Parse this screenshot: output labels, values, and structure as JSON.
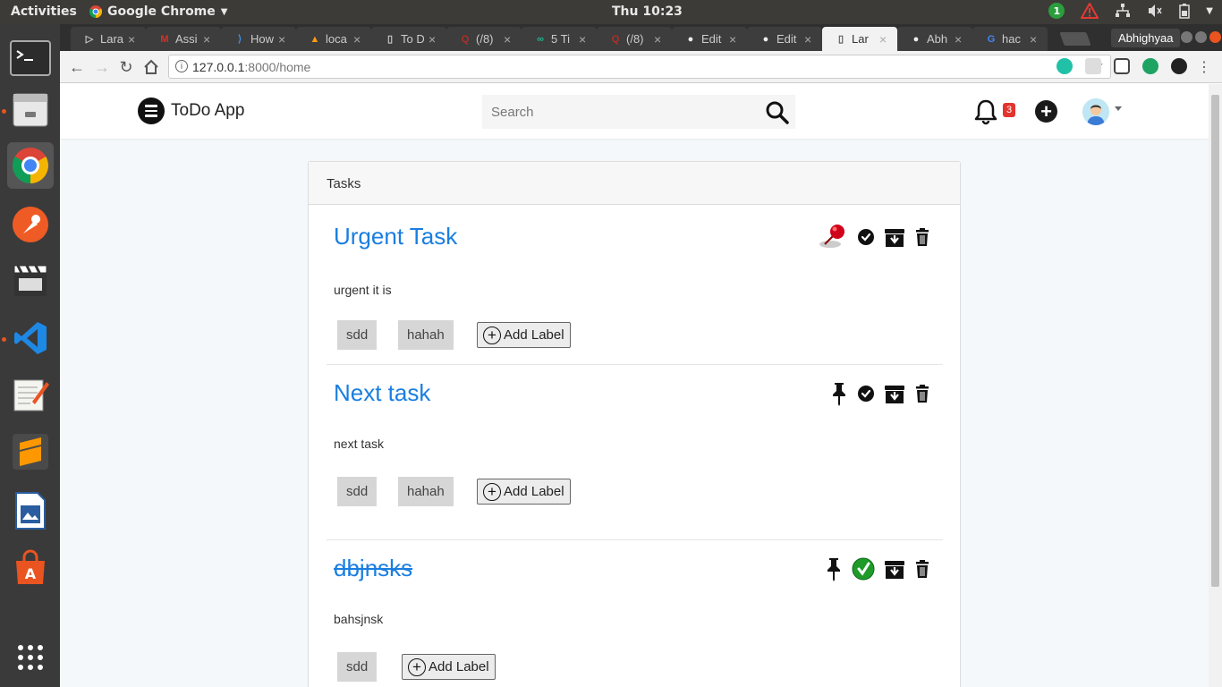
{
  "topbar": {
    "activities": "Activities",
    "app_name": "Google Chrome",
    "clock": "Thu 10:23",
    "notif_count": "1"
  },
  "dock": {
    "apps": [
      "terminal-icon",
      "files-icon",
      "chrome-icon",
      "postman-icon",
      "video-editor-icon",
      "vscode-icon",
      "text-editor-icon",
      "sublime-icon",
      "writer-icon",
      "software-center-icon",
      "app-grid-icon"
    ]
  },
  "browser": {
    "tabs": [
      {
        "label": "Lara",
        "icon": "laravel-icon"
      },
      {
        "label": "Assi",
        "icon": "gmail-icon"
      },
      {
        "label": "How",
        "icon": "stackexchange-icon"
      },
      {
        "label": "loca",
        "icon": "phpmyadmin-icon"
      },
      {
        "label": "To D",
        "icon": "page-icon"
      },
      {
        "label": "(/8)",
        "icon": "quora-icon"
      },
      {
        "label": "5 Ti",
        "icon": "link-icon"
      },
      {
        "label": "(/8)",
        "icon": "quora-icon"
      },
      {
        "label": "Edit",
        "icon": "github-icon"
      },
      {
        "label": "Edit",
        "icon": "github-icon"
      },
      {
        "label": "Lar",
        "icon": "page-icon"
      },
      {
        "label": "Abh",
        "icon": "github-icon"
      },
      {
        "label": "hac",
        "icon": "google-icon"
      }
    ],
    "profile": "Abhighyaa",
    "url_host": "127.0.0.1",
    "url_rest": ":8000/home"
  },
  "app": {
    "brand": "ToDo App",
    "search_placeholder": "Search",
    "notification_count": "3",
    "card_title": "Tasks",
    "add_label_text": "Add Label",
    "tasks": [
      {
        "title": "Urgent Task",
        "description": "urgent it is",
        "labels": [
          "sdd",
          "hahah"
        ],
        "pinned": true,
        "completed": false
      },
      {
        "title": "Next task",
        "description": "next task",
        "labels": [
          "sdd",
          "hahah"
        ],
        "pinned": false,
        "completed": false
      },
      {
        "title": "dbjnsks",
        "description": "bahsjnsk",
        "labels": [
          "sdd"
        ],
        "pinned": false,
        "completed": true
      }
    ]
  }
}
